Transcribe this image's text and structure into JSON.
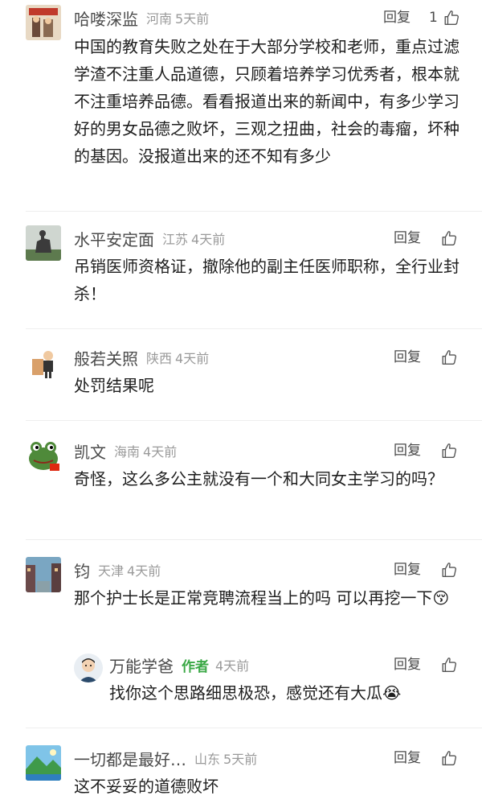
{
  "comments": [
    {
      "avatar_icon": "book-cover-avatar-icon",
      "name": "哈喽深监",
      "region": "河南",
      "time": "5天前",
      "reply_label": "回复",
      "like_count": "1",
      "text": "中国的教育失败之处在于大部分学校和老师，重点过滤学渣不注重人品道德，只顾着培养学习优秀者，根本就不注重培养品德。看看报道出来的新闻中，有多少学习好的男女品德之败坏，三观之扭曲，社会的毒瘤，坏种的基因。没报道出来的还不知有多少"
    },
    {
      "avatar_icon": "horse-statue-avatar-icon",
      "name": "水平安定面",
      "region": "江苏",
      "time": "4天前",
      "reply_label": "回复",
      "text": "吊销医师资格证，撤除他的副主任医师职称，全行业封杀！"
    },
    {
      "avatar_icon": "cartoon-person-avatar-icon",
      "name": "般若关照",
      "region": "陕西",
      "time": "4天前",
      "reply_label": "回复",
      "text": "处罚结果呢"
    },
    {
      "avatar_icon": "frog-avatar-icon",
      "name": "凯文",
      "region": "海南",
      "time": "4天前",
      "reply_label": "回复",
      "text": "奇怪，这么多公主就没有一个和大同女主学习的吗？"
    },
    {
      "avatar_icon": "street-scene-avatar-icon",
      "name": "钧",
      "region": "天津",
      "time": "4天前",
      "reply_label": "回复",
      "text": "那个护士长是正常竞聘流程当上的吗  可以再挖一下😚"
    },
    {
      "avatar_icon": "author-portrait-avatar-icon",
      "name": "万能学爸",
      "author_tag": "作者",
      "time": "4天前",
      "reply_label": "回复",
      "text": "找你这个思路细思极恐，感觉还有大瓜😭"
    },
    {
      "avatar_icon": "landscape-avatar-icon",
      "name": "一切都是最好…",
      "region": "山东",
      "time": "5天前",
      "reply_label": "回复",
      "text": "这不妥妥的道德败坏"
    }
  ],
  "colors": {
    "name": "#4a4a4a",
    "meta": "#9a9a9a",
    "author_tag": "#3aa845",
    "body": "#1e1e1e"
  }
}
